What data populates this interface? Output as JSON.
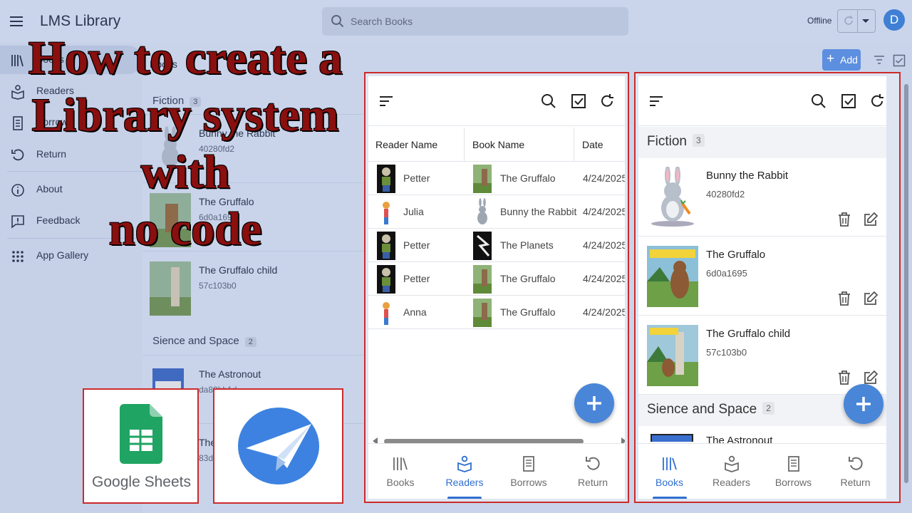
{
  "app": {
    "title": "LMS Library",
    "search_placeholder": "Search Books",
    "status": "Offline",
    "avatar_initial": "D",
    "add_label": "Add",
    "accent_color": "#4a86d8",
    "border_color": "#cc2a2a"
  },
  "sidebar": {
    "items": [
      {
        "label": "Books",
        "icon": "books-icon"
      },
      {
        "label": "Readers",
        "icon": "readers-icon"
      },
      {
        "label": "Borrows",
        "icon": "borrows-icon"
      },
      {
        "label": "Return",
        "icon": "return-icon"
      },
      {
        "label": "About",
        "icon": "info-icon"
      },
      {
        "label": "Feedback",
        "icon": "feedback-icon"
      },
      {
        "label": "App Gallery",
        "icon": "grid-icon"
      }
    ]
  },
  "bg_list": {
    "header": "Books",
    "group_fiction": "Fiction",
    "group_fiction_count": "3",
    "group_space": "Sience and Space",
    "group_space_count": "2",
    "rows": [
      {
        "title": "Bunny the Rabbit",
        "id": "40280fd2"
      },
      {
        "title": "The Gruffalo",
        "id": "6d0a1695"
      },
      {
        "title": "The Gruffalo child",
        "id": "57c103b0"
      },
      {
        "title": "The Astronout",
        "id": "da80bb1d"
      },
      {
        "title": "The Planets",
        "id": "83d"
      }
    ]
  },
  "overlay": {
    "lines": [
      "How to create a",
      "Library system",
      "with",
      "no code"
    ]
  },
  "logos": {
    "sheets_label": "Google Sheets"
  },
  "borrows_panel": {
    "columns": [
      "Reader Name",
      "Book Name",
      "Date"
    ],
    "rows": [
      {
        "reader": "Petter",
        "book": "The Gruffalo",
        "date": "4/24/2025"
      },
      {
        "reader": "Julia",
        "book": "Bunny the Rabbit",
        "date": "4/24/2025"
      },
      {
        "reader": "Petter",
        "book": "The Planets",
        "date": "4/24/2025"
      },
      {
        "reader": "Petter",
        "book": "The Gruffalo",
        "date": "4/24/2025"
      },
      {
        "reader": "Anna",
        "book": "The Gruffalo",
        "date": "4/24/2025"
      }
    ],
    "nav": [
      "Books",
      "Readers",
      "Borrows",
      "Return"
    ],
    "active_tab": "Readers"
  },
  "books_panel": {
    "group_fiction": "Fiction",
    "group_fiction_count": "3",
    "books": [
      {
        "title": "Bunny the Rabbit",
        "id": "40280fd2"
      },
      {
        "title": "The Gruffalo",
        "id": "6d0a1695"
      },
      {
        "title": "The Gruffalo child",
        "id": "57c103b0"
      }
    ],
    "group_space": "Sience and Space",
    "group_space_count": "2",
    "partial_book": "The Astronout",
    "nav": [
      "Books",
      "Readers",
      "Borrows",
      "Return"
    ],
    "active_tab": "Books"
  }
}
